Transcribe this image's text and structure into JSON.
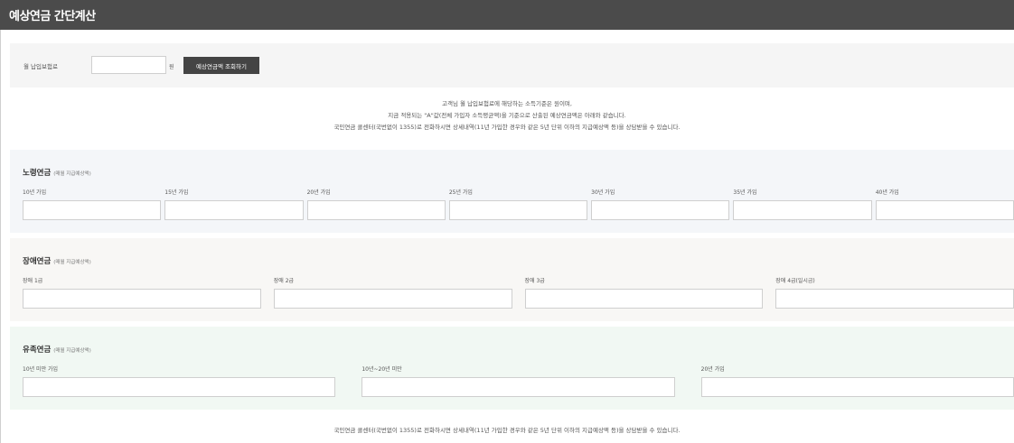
{
  "header": {
    "title": "예상연금 간단계산"
  },
  "input": {
    "label": "월 납입보험료",
    "value": "",
    "unit": "원",
    "button_label": "예상연금액 조회하기"
  },
  "notice_top": {
    "line1": "고객님 월 납입보험료에 해당하는 소득기준은 원이며,",
    "line2": "지금 적용되는 \"A\"값(전체 가입자 소득평균액)을 기준으로 산출된 예상연금액은 아래와 같습니다.",
    "line3": "국민연금 콜센터(국번없이 1355)로 전화하시면 상세내역(11년 가입한 경우와 같은 5년 단위 이하의 지급예상액 등)을 상담받을 수 있습니다."
  },
  "sections": [
    {
      "title": "노령연금",
      "subtitle": "(매월 지급예상액)",
      "columns": [
        {
          "label": "10년 가입",
          "value": ""
        },
        {
          "label": "15년 가입",
          "value": ""
        },
        {
          "label": "20년 가입",
          "value": ""
        },
        {
          "label": "25년 가입",
          "value": ""
        },
        {
          "label": "30년 가입",
          "value": ""
        },
        {
          "label": "35년 가입",
          "value": ""
        },
        {
          "label": "40년 가입",
          "value": ""
        }
      ]
    },
    {
      "title": "장애연금",
      "subtitle": "(매월 지급예상액)",
      "columns": [
        {
          "label": "장애 1급",
          "value": ""
        },
        {
          "label": "장애 2급",
          "value": ""
        },
        {
          "label": "장애 3급",
          "value": ""
        },
        {
          "label": "장애 4급(일시금)",
          "value": ""
        }
      ]
    },
    {
      "title": "유족연금",
      "subtitle": "(매월 지급예상액)",
      "columns": [
        {
          "label": "10년 미만 가입",
          "value": ""
        },
        {
          "label": "10년~20년 미만",
          "value": ""
        },
        {
          "label": "20년 가입",
          "value": ""
        }
      ]
    }
  ],
  "notice_bottom": "국민연금 콜센터(국번없이 1355)로 전화하시면 상세내역(11년 가입한 경우와 같은 5년 단위 이하의 지급예상액 등)을 상담받을 수 있습니다."
}
